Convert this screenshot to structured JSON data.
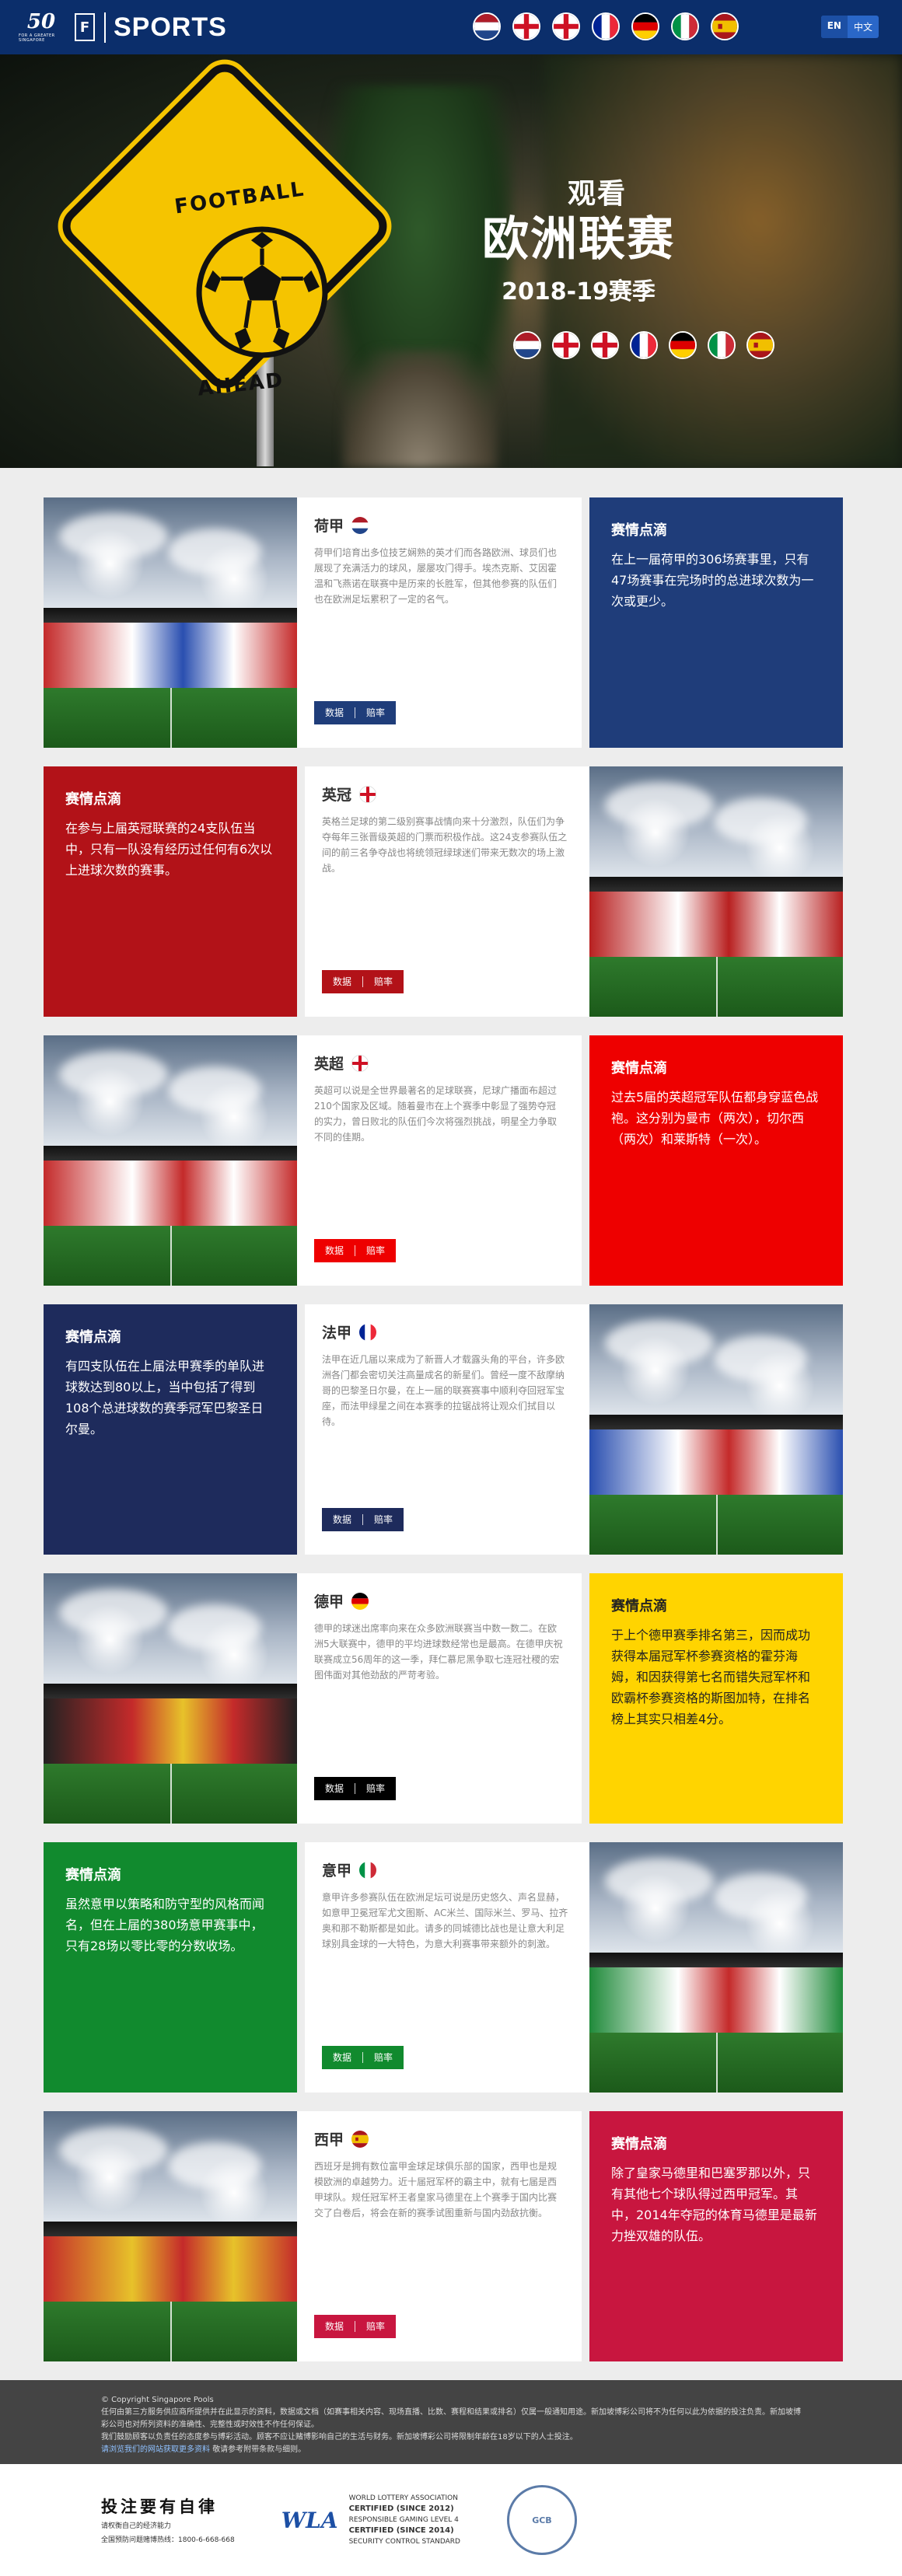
{
  "header": {
    "logo_number": "50",
    "logo_tagline": "FOR A GREATER SINGAPORE",
    "logo_fs": "F",
    "brand": "SPORTS",
    "lang_en": "EN",
    "lang_zh": "中文",
    "flags": [
      "netherlands",
      "england",
      "england",
      "france",
      "germany",
      "italy",
      "spain"
    ]
  },
  "hero": {
    "sign_line1": "FOOTBALL",
    "sign_line2": "AHEAD",
    "title_line1": "观看",
    "title_line2": "欧洲联赛",
    "title_line3": "2018-19赛季",
    "flags": [
      "netherlands",
      "england",
      "england",
      "france",
      "germany",
      "italy",
      "spain"
    ]
  },
  "leagues": [
    {
      "name": "荷甲",
      "flag": "netherlands",
      "color": "#1f3d7a",
      "body": "荷甲们培育出多位技艺娴熟的英才们而各路欧洲、球员们也展现了充满活力的球风，屡屡攻门得手。埃杰克斯、艾因霍温和飞燕诺在联赛中是历来的长胜军，但其他参赛的队伍们也在欧洲足坛累积了一定的名气。",
      "btn_data": "数据",
      "btn_odds": "赔率",
      "insight_title": "赛情点滴",
      "insight": "在上一届荷甲的306场赛事里，只有47场赛事在完场时的总进球次数为一次或更少。"
    },
    {
      "name": "英冠",
      "flag": "england",
      "color": "#b21218",
      "body": "英格兰足球的第二级别赛事战情向来十分激烈，队伍们为争夺每年三张晋级英超的门票而积极作战。这24支参赛队伍之间的前三名争夺战也将统领冠绿球迷们带来无数次的场上激战。",
      "btn_data": "数据",
      "btn_odds": "赔率",
      "insight_title": "赛情点滴",
      "insight": "在参与上届英冠联赛的24支队伍当中，只有一队没有经历过任何有6次以上进球次数的赛事。"
    },
    {
      "name": "英超",
      "flag": "england",
      "color": "#ee0000",
      "body": "英超可以说是全世界最著名的足球联赛，尼球广播面布超过210个国家及区域。随着曼市在上个赛季中彰显了强势夺冠的实力，曾日败北的队伍们今次将强烈挑战，明星全力争取不同的佳期。",
      "btn_data": "数据",
      "btn_odds": "赔率",
      "insight_title": "赛情点滴",
      "insight": "过去5届的英超冠军队伍都身穿蓝色战袍。这分别为曼市（两次），切尔西（两次）和莱斯特（一次）。"
    },
    {
      "name": "法甲",
      "flag": "france",
      "color": "#1e2b5c",
      "body": "法甲在近几届以来成为了新晋人才载露头角的平台，许多欧洲各门都会密切关注高量成名的新星们。曾经一度不敌摩纳哥的巴黎圣日尔曼，在上一届的联赛赛事中顺利夺回冠军宝座，而法甲绿星之间在本赛季的拉锯战将让观众们拭目以待。",
      "btn_data": "数据",
      "btn_odds": "赔率",
      "insight_title": "赛情点滴",
      "insight": "有四支队伍在上届法甲赛季的单队进球数达到80以上，当中包括了得到108个总进球数的赛季冠军巴黎圣日尔曼。"
    },
    {
      "name": "德甲",
      "flag": "germany",
      "color": "#000000",
      "body": "德甲的球迷出席率向来在众多欧洲联赛当中数一数二。在欧洲5大联赛中，德甲的平均进球数经常也是最高。在德甲庆祝联赛成立56周年的这一季，拜仁慕尼黑争取七连冠社稷的宏图伟面对其他劲敌的严苛考验。",
      "btn_data": "数据",
      "btn_odds": "赔率",
      "insight_title": "赛情点滴",
      "insight": "于上个德甲赛季排名第三，因而成功获得本届冠军杯参赛资格的霍芬海姆，和因获得第七名而错失冠军杯和欧霸杯参赛资格的斯图加特，在排名榜上其实只相差4分。"
    },
    {
      "name": "意甲",
      "flag": "italy",
      "color": "#118a2e",
      "body": "意甲许多参赛队伍在欧洲足坛可说是历史悠久、声名显赫，如意甲卫冕冠军尤文图斯、AC米兰、国际米兰、罗马、拉齐奥和那不勒斯都是如此。请多的同城德比战也是让意大利足球别具金球的一大特色，为意大利赛事带来额外的刺激。",
      "btn_data": "数据",
      "btn_odds": "赔率",
      "insight_title": "赛情点滴",
      "insight": "虽然意甲以策略和防守型的风格而闻名，但在上届的380场意甲赛事中，只有28场以零比零的分数收场。"
    },
    {
      "name": "西甲",
      "flag": "spain",
      "color": "#c8163f",
      "body": "西班牙是拥有数位富甲金球足球俱乐部的国家，西甲也是规模欧洲的卓越势力。近十届冠军杯的霸主中，就有七届是西甲球队。规任冠军杯王者皇家马德里在上个赛季于国内比赛交了白卷后，将会在新的赛季试图重新与国内劲敌抗衡。",
      "btn_data": "数据",
      "btn_odds": "赔率",
      "insight_title": "赛情点滴",
      "insight": "除了皇家马德里和巴塞罗那以外，只有其他七个球队得过西甲冠军。其中，2014年夺冠的体育马德里是最新力挫双雄的队伍。"
    }
  ],
  "footer": {
    "copyright": "© Copyright Singapore Pools",
    "line1": "任何由第三方服务供应商所提供并在此显示的资料，数据或文档（如赛事相关内容、现场直播、比数、赛程和结果或排名）仅属一般通知用途。新加坡博彩公司将不为任何以此为依据的投注负责。新加坡博彩公司也对所列资料的准确性、完整性或时效性不作任何保证。",
    "line2": "我们鼓励顾客以负责任的态度参与博彩活动。顾客不应让赌博影响自己的生活与财务。新加坡博彩公司将限制年龄在18岁以下的人士投注。",
    "link": "请浏览我们的网站获取更多资料",
    "line3": "敬请参考附带条款与细则。"
  },
  "bottom": {
    "resp_title": "投注要有自律",
    "resp_sub1": "请权衡自己的经济能力",
    "resp_sub2": "全国预防问题赌博热线：1800-6-668-668",
    "wla": "WLA",
    "wla_l1": "WORLD LOTTERY ASSOCIATION",
    "wla_c1": "CERTIFIED (SINCE 2012)",
    "wla_c2": "RESPONSIBLE GAMING LEVEL 4",
    "wla_c3": "CERTIFIED (SINCE 2014)",
    "wla_c4": "SECURITY CONTROL STANDARD",
    "gcb": "GCB"
  }
}
